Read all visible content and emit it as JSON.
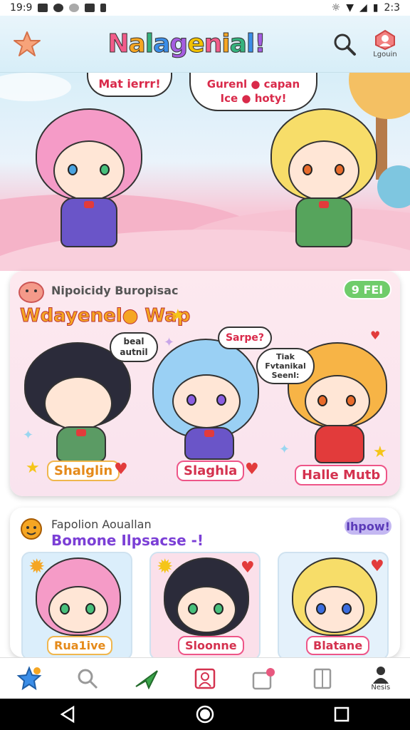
{
  "status": {
    "time_left": "19:9",
    "time_right": "2:3"
  },
  "header": {
    "title": "Nalagenial!",
    "login_label": "Lgouin"
  },
  "hero": {
    "bubble_left": "Mat ierrr!",
    "bubble_right_line1": "Gurenl ● capan",
    "bubble_right_line2": "Ice ● hoty!"
  },
  "card1": {
    "section": "Nipoicidy Buropisac",
    "title": "Wdayenel● Wap",
    "badge": "9 FEI",
    "bubble_a_line1": "beal",
    "bubble_a_line2": "autnil",
    "bubble_b": "Sarpe?",
    "bubble_c_line1": "Tiak",
    "bubble_c_line2": "Fvtanikal",
    "bubble_c_line3": "Seenl:",
    "characters": [
      {
        "name": "Shalglin"
      },
      {
        "name": "Slaghla"
      },
      {
        "name": "Halle Mutb"
      }
    ]
  },
  "card2": {
    "section": "Fapolion Aouallan",
    "title": "Bomone Ilpsacse -!",
    "badge": "Ihpow!",
    "characters": [
      {
        "name": "Rua1ive"
      },
      {
        "name": "Sloonne"
      },
      {
        "name": "Blatane"
      }
    ]
  },
  "nav": {
    "profile_label": "Nesis"
  },
  "colors": {
    "accent_pink": "#e8587f",
    "accent_green": "#5cc47a",
    "accent_purple": "#b9a9ef"
  }
}
